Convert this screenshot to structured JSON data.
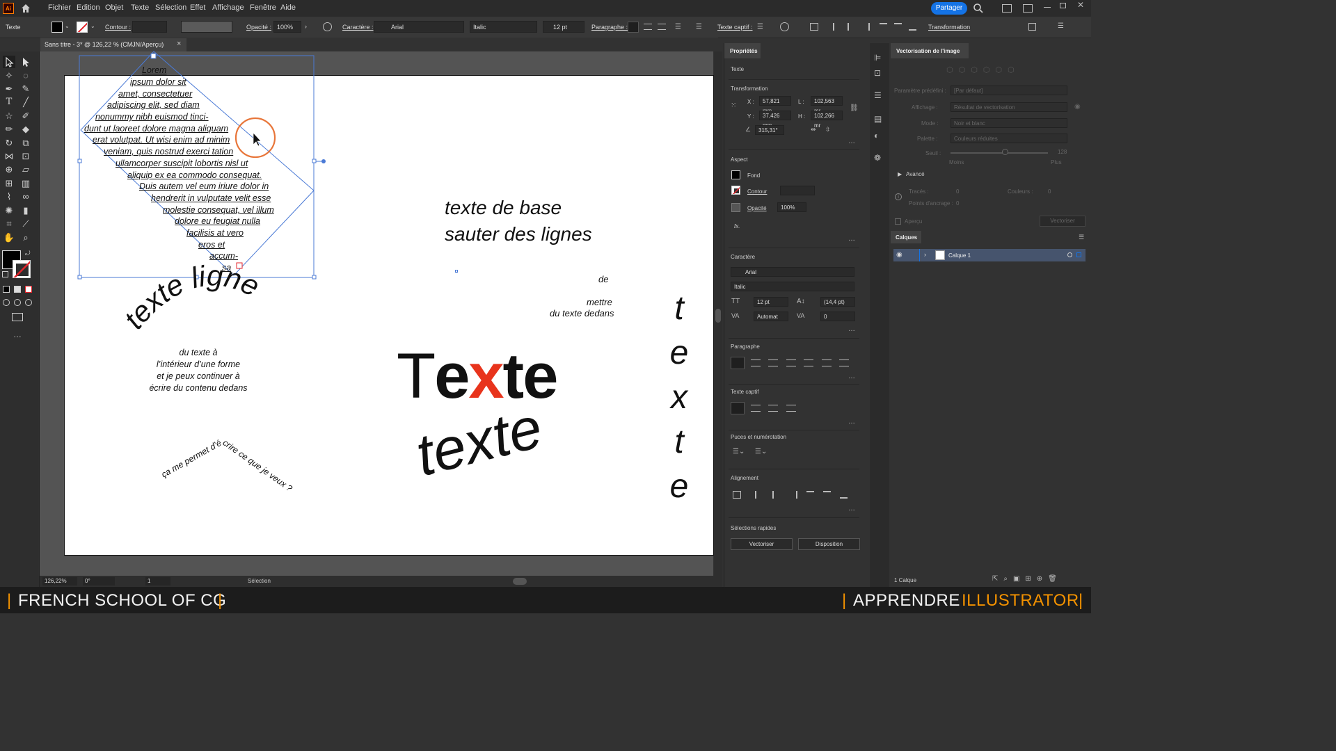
{
  "menubar": {
    "app_icon": "Ai",
    "items": [
      "Fichier",
      "Edition",
      "Objet",
      "Texte",
      "Sélection",
      "Effet",
      "Affichage",
      "Fenêtre",
      "Aide"
    ],
    "share_label": "Partager"
  },
  "control": {
    "tool_label": "Texte",
    "stroke_label": "Contour :",
    "opacity_label": "Opacité :",
    "opacity_value": "100%",
    "character_label": "Caractère :",
    "font_value": "Arial",
    "style_value": "Italic",
    "size_value": "12 pt",
    "paragraph_label": "Paragraphe :",
    "captif_label": "Texte captif :",
    "transform_label": "Transformation"
  },
  "doc": {
    "tab_title": "Sans titre - 3* @ 126,22 % (CMJN/Aperçu)",
    "close": "×"
  },
  "artboard": {
    "area_text_lines": [
      "Lorem",
      "ipsum dolor sit",
      "amet, consectetuer",
      "adipiscing elit, sed diam",
      "nonummy nibh euismod tinci-",
      "dunt ut laoreet dolore magna aliquam",
      "erat volutpat. Ut wisi enim ad minim",
      "veniam, quis nostrud exerci tation",
      "ullamcorper suscipit lobortis nisl ut",
      "aliquip ex ea commodo consequat.",
      "Duis autem vel eum iriure dolor in",
      "hendrerit in vulputate velit esse",
      "molestie consequat, vel illum",
      "dolore eu feugiat nulla",
      "facilisis at vero",
      "eros et",
      "accum-",
      "sa"
    ],
    "path_text_arc": "texte ligne",
    "shape_text_lines": [
      "du texte à",
      "l’intérieur d’une forme",
      "et je peux continuer à",
      "écrire du contenu dedans"
    ],
    "path_text_chevron": "ça me permet d’écrire ce que je veux ?",
    "base_text_lines": [
      "texte de base",
      "sauter des lignes"
    ],
    "small_text": [
      "de",
      "mettre",
      "du texte dedans"
    ],
    "big_text": {
      "T": "T",
      "e1": "e",
      "x": "x",
      "t": "t",
      "e2": "e"
    },
    "warp_text": "texte",
    "vertical_text": [
      "t",
      "e",
      "x",
      "t",
      "e"
    ]
  },
  "status": {
    "zoom": "126,22%",
    "angle": "0°",
    "page": "1",
    "tool": "Sélection"
  },
  "props": {
    "tab": "Propriétés",
    "section_texte": "Texte",
    "section_transform": "Transformation",
    "x_label": "X :",
    "x_value": "57,821 mm",
    "y_label": "Y :",
    "y_value": "37,426 mm",
    "l_label": "L :",
    "l_value": "102,563 mr",
    "h_label": "H :",
    "h_value": "102,266 mr",
    "angle_value": "315,31°",
    "section_aspect": "Aspect",
    "fond_label": "Fond",
    "contour_label": "Contour",
    "opacite_label": "Opacité",
    "opacite_value": "100%",
    "fx": "fx.",
    "section_caractere": "Caractère",
    "font_value": "Arial",
    "style_value": "Italic",
    "size_value": "12 pt",
    "leading_value": "(14,4 pt)",
    "kerning_value": "Automat",
    "tracking_value": "0",
    "section_paragraphe": "Paragraphe",
    "section_captif": "Texte captif",
    "section_puces": "Puces et numérotation",
    "section_alignement": "Alignement",
    "section_rapides": "Sélections rapides",
    "btn_vectoriser": "Vectoriser",
    "btn_disposition": "Disposition"
  },
  "vectorize": {
    "title": "Vectorisation de l'image",
    "preset_label": "Paramètre prédéfini :",
    "preset_value": "[Par défaut]",
    "display_label": "Affichage :",
    "display_value": "Résultat de vectorisation",
    "mode_label": "Mode :",
    "mode_value": "Noir et blanc",
    "palette_label": "Palette :",
    "palette_value": "Couleurs réduites",
    "seuil_label": "Seuil :",
    "seuil_value": "128",
    "moins": "Moins",
    "plus": "Plus",
    "avance": "Avancé",
    "traces_label": "Tracés :",
    "traces_value": "0",
    "couleurs_label": "Couleurs :",
    "couleurs_value": "0",
    "points_label": "Points d'ancrage :",
    "points_value": "0",
    "apercu": "Aperçu",
    "btn_vectoriser": "Vectoriser"
  },
  "layers": {
    "title": "Calques",
    "layer_name": "Calque 1",
    "count": "1 Calque"
  },
  "footer": {
    "left": "FRENCH SCHOOL OF CG",
    "right_white": "APPRENDRE",
    "right_orange": "ILLUSTRATOR",
    "bar": "|"
  },
  "colors": {
    "accent_blue": "#1473e6",
    "selection_blue": "#4a7ad6",
    "footer_orange": "#f39200",
    "text_red": "#e8341c",
    "cursor_ring": "#e8763a"
  }
}
